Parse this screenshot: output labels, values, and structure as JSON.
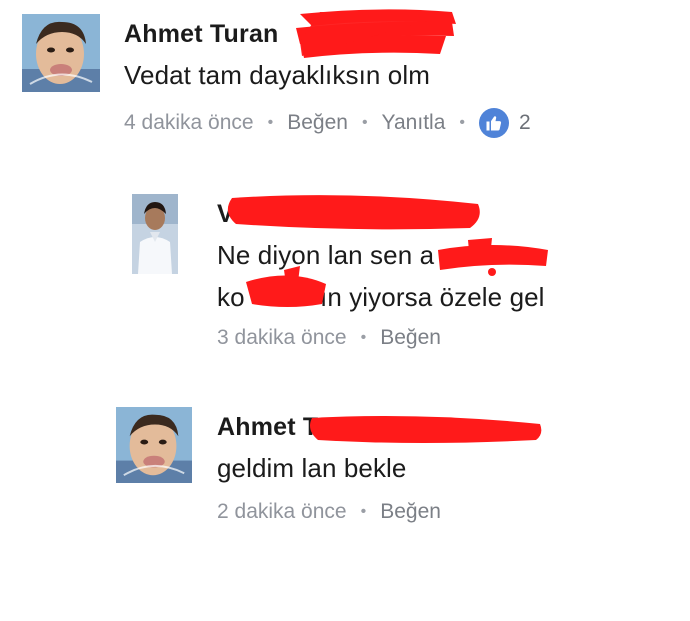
{
  "comments": [
    {
      "author": "Ahmet Turan",
      "text": "Vedat tam dayaklıksın olm",
      "time": "4 dakika önce",
      "like_label": "Beğen",
      "reply_label": "Yanıtla",
      "like_count": "2",
      "avatar_icon": "profile-photo-boy-face"
    },
    {
      "author": "V",
      "text_line1": "Ne diyon lan sen a",
      "text_line2_start": "ko",
      "text_line2_end": "ın yiyorsa özele gel",
      "time": "3 dakika önce",
      "like_label": "Beğen",
      "avatar_icon": "profile-photo-boy-white-shirt"
    },
    {
      "author": "Ahmet Tu",
      "text": "geldim lan bekle",
      "time": "2 dakika önce",
      "like_label": "Beğen",
      "avatar_icon": "profile-photo-boy-face"
    }
  ],
  "colors": {
    "meta_text": "#90949c",
    "like_badge": "#4f83d8",
    "redaction": "#ff1a1a",
    "body_text": "#1b1b1b"
  },
  "icons": {
    "like_badge_icon": "thumbs-up-icon",
    "separator": "•"
  }
}
